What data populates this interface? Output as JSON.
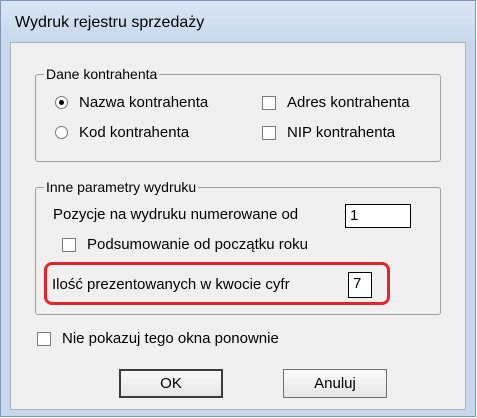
{
  "window": {
    "title": "Wydruk rejestru sprzedaży"
  },
  "group_contractor": {
    "legend": "Dane kontrahenta",
    "name_radio": {
      "label": "Nazwa kontrahenta",
      "selected": true
    },
    "code_radio": {
      "label": "Kod kontrahenta",
      "selected": false
    },
    "address_checkbox": {
      "label": "Adres kontrahenta",
      "checked": false
    },
    "nip_checkbox": {
      "label": "NIP kontrahenta",
      "checked": false
    }
  },
  "group_other": {
    "legend": "Inne parametry wydruku",
    "numbering_label": "Pozycje na wydruku numerowane od",
    "numbering_value": "1",
    "summary_checkbox": {
      "label": "Podsumowanie od początku roku",
      "checked": false
    },
    "digits_label": "Ilość prezentowanych w kwocie cyfr",
    "digits_value": "7"
  },
  "dont_show_checkbox": {
    "label": "Nie pokazuj tego okna ponownie",
    "checked": false
  },
  "buttons": {
    "ok": "OK",
    "cancel": "Anuluj"
  },
  "colors": {
    "highlight": "#e5232a",
    "window_frame": "#c8d8ec"
  }
}
